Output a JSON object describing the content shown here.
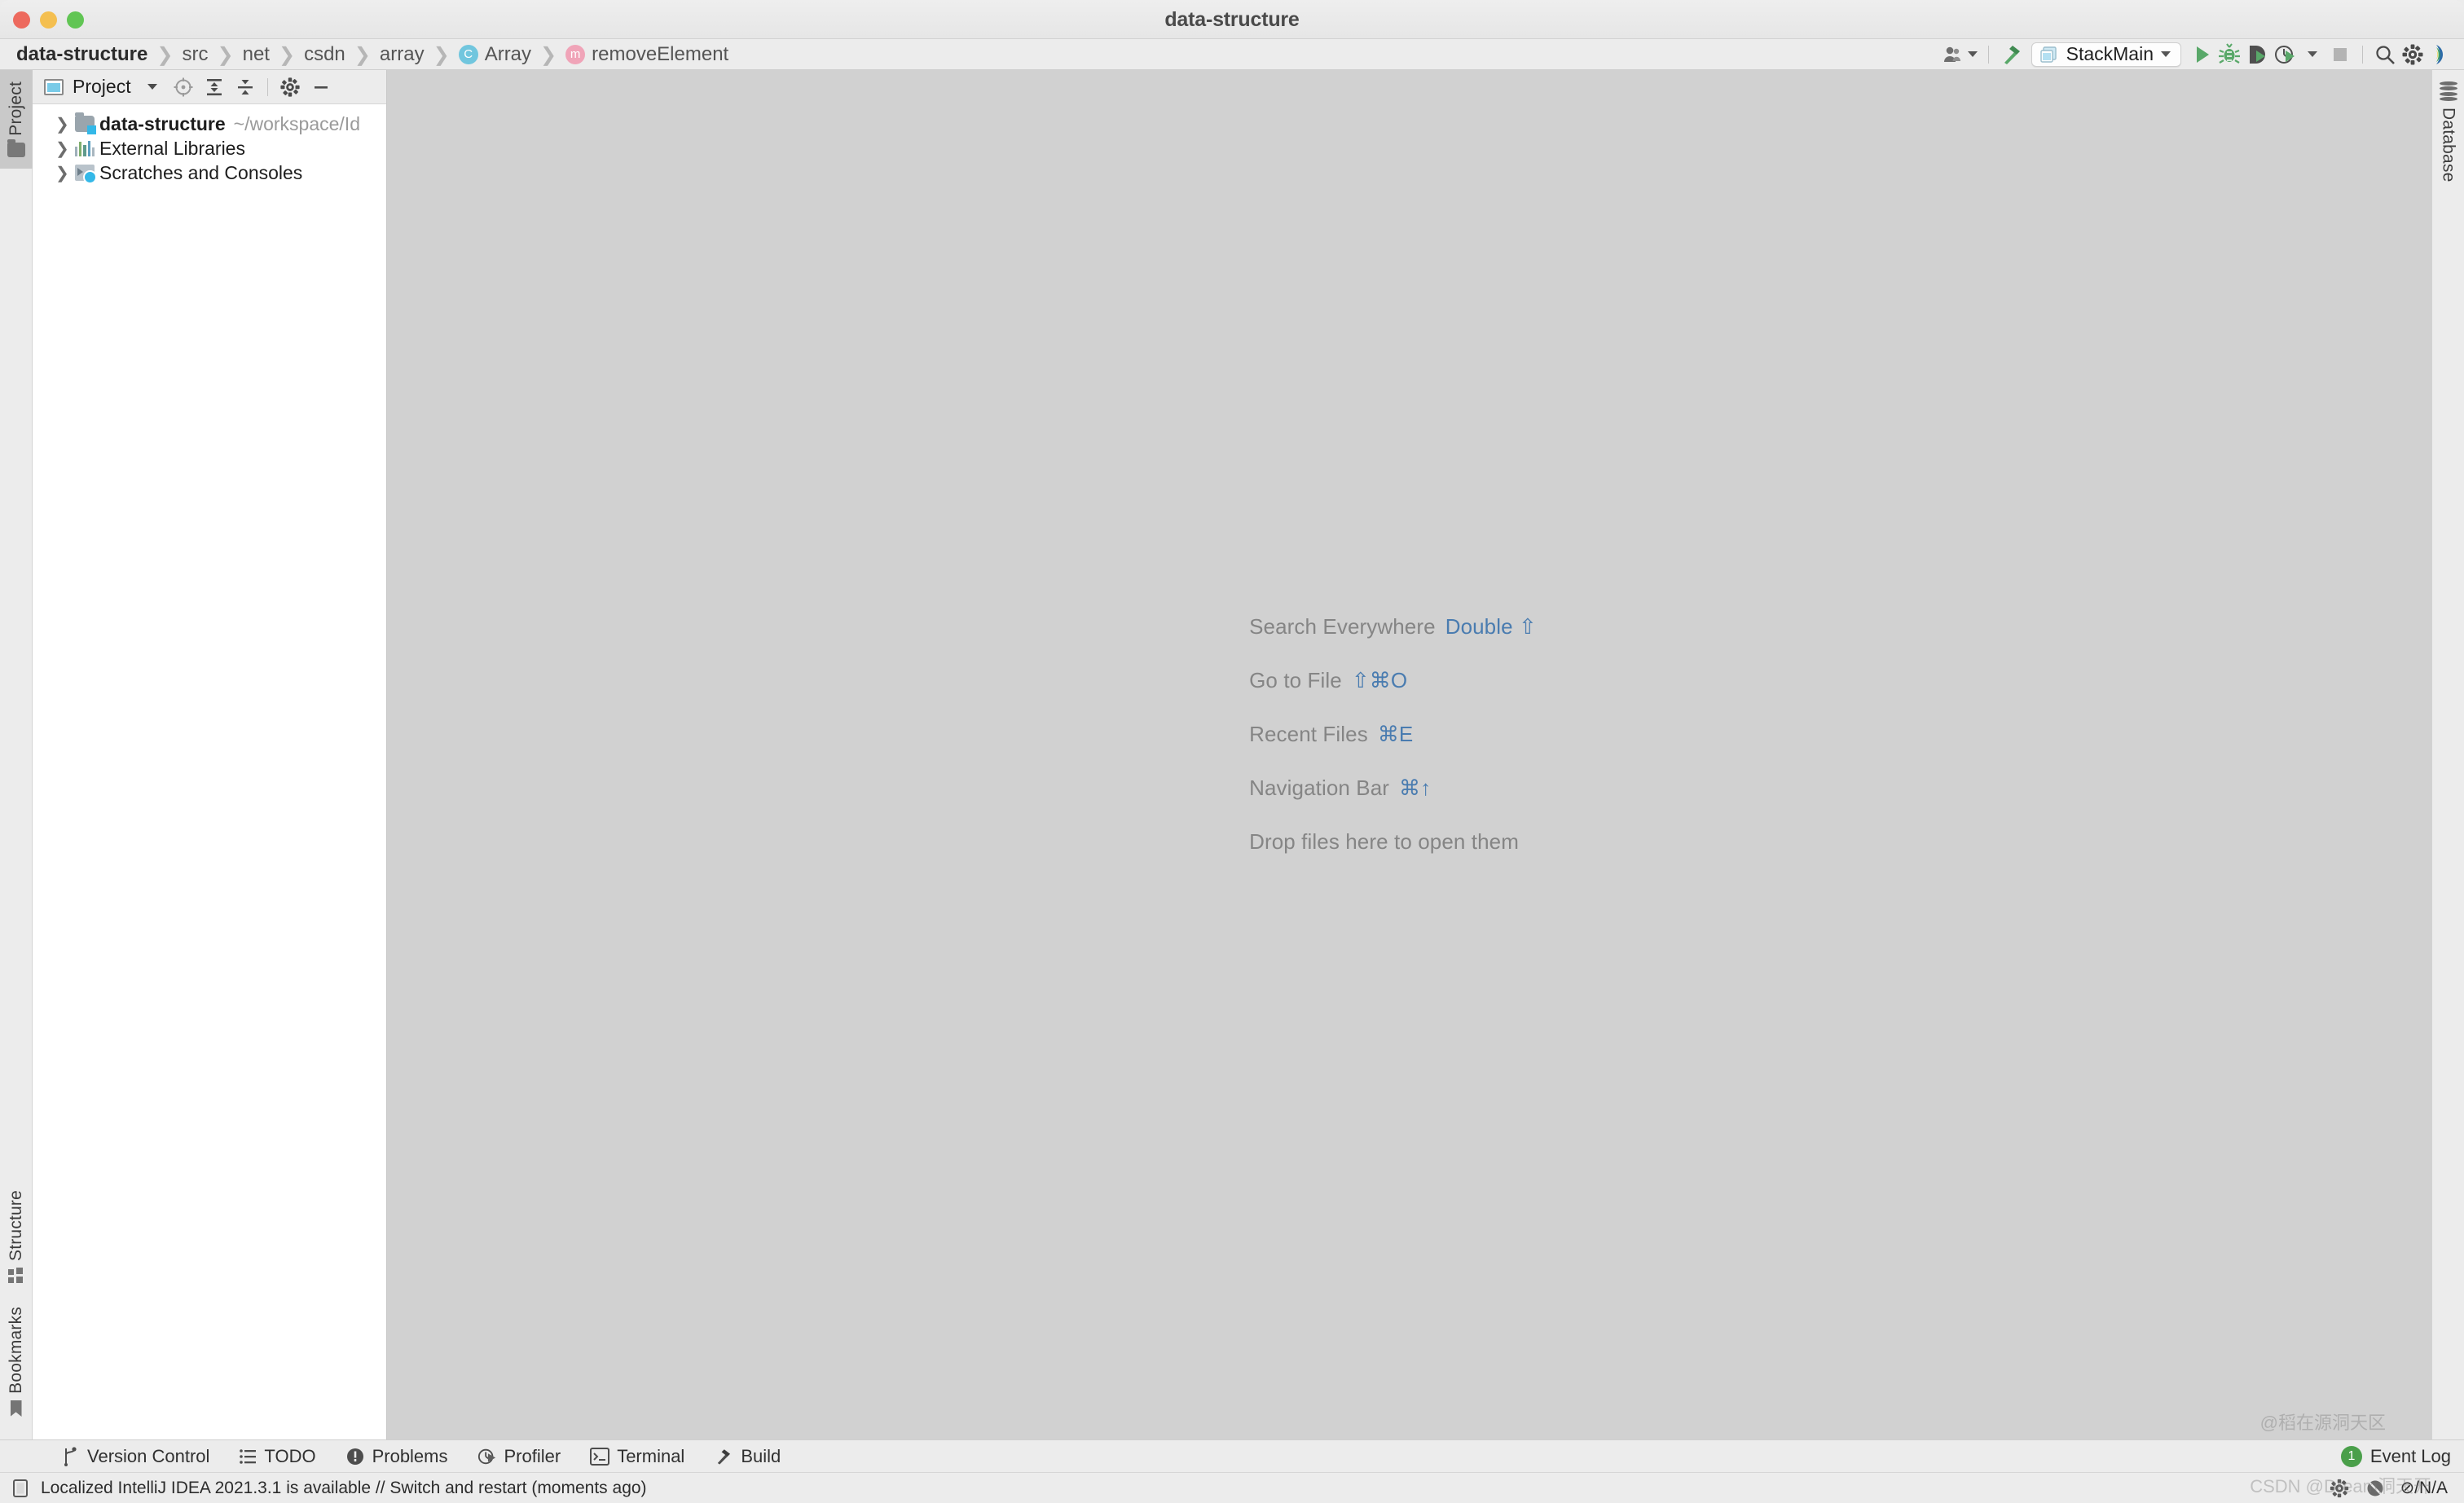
{
  "window": {
    "title": "data-structure",
    "traffic_lights": [
      "close",
      "minimize",
      "maximize"
    ]
  },
  "breadcrumb": [
    {
      "label": "data-structure",
      "icon": ""
    },
    {
      "label": "src",
      "icon": ""
    },
    {
      "label": "net",
      "icon": ""
    },
    {
      "label": "csdn",
      "icon": ""
    },
    {
      "label": "array",
      "icon": ""
    },
    {
      "label": "Array",
      "icon": "class-icon",
      "badge": "C"
    },
    {
      "label": "removeElement",
      "icon": "method-icon",
      "badge": "m"
    }
  ],
  "toolbar": {
    "avatar_label": "account-icon",
    "build_label": "build-hammer-icon",
    "run_config": "StackMain",
    "run_label": "run-icon",
    "debug_label": "debug-icon",
    "coverage_label": "run-with-coverage-icon",
    "profiler_label": "profile-icon",
    "stop_label": "stop-icon",
    "search_label": "search-icon",
    "settings_label": "settings-gear-icon",
    "updates_label": "ide-updates-icon"
  },
  "project_panel": {
    "title": "Project",
    "buttons": [
      "select-opened-file-icon",
      "expand-all-icon",
      "collapse-all-icon",
      "settings-gear-icon",
      "hide-icon"
    ],
    "tree": [
      {
        "label": "data-structure",
        "sub": "~/workspace/Id",
        "icon": "module-icon",
        "bold": true,
        "expanded": false
      },
      {
        "label": "External Libraries",
        "sub": "",
        "icon": "library-icon",
        "bold": false,
        "expanded": false
      },
      {
        "label": "Scratches and Consoles",
        "sub": "",
        "icon": "scratch-icon",
        "bold": false,
        "expanded": false
      }
    ]
  },
  "stripes": {
    "left_top": [
      {
        "label": "Project",
        "icon": "folder-icon",
        "active": true
      }
    ],
    "left_bottom": [
      {
        "label": "Structure",
        "icon": "structure-icon",
        "active": false
      },
      {
        "label": "Bookmarks",
        "icon": "bookmark-icon",
        "active": false
      }
    ],
    "right_top": [
      {
        "label": "Database",
        "icon": "database-icon",
        "active": false
      }
    ]
  },
  "editor_hints": [
    {
      "text": "Search Everywhere",
      "keys": "Double ⇧"
    },
    {
      "text": "Go to File",
      "keys": "⇧⌘O"
    },
    {
      "text": "Recent Files",
      "keys": "⌘E"
    },
    {
      "text": "Navigation Bar",
      "keys": "⌘↑"
    },
    {
      "text": "Drop files here to open them",
      "keys": ""
    }
  ],
  "bottom_bar": {
    "items": [
      {
        "label": "Version Control",
        "icon": "branch-icon"
      },
      {
        "label": "TODO",
        "icon": "todo-list-icon"
      },
      {
        "label": "Problems",
        "icon": "problems-icon"
      },
      {
        "label": "Profiler",
        "icon": "profiler-icon"
      },
      {
        "label": "Terminal",
        "icon": "terminal-icon"
      },
      {
        "label": "Build",
        "icon": "build-hammer-icon"
      }
    ],
    "event_log": {
      "label": "Event Log",
      "count": "1"
    }
  },
  "status_bar": {
    "icon": "notification-widget-icon",
    "message": "Localized IntelliJ IDEA 2021.3.1 is available // Switch and restart (moments ago)",
    "memory": "⊘/N/A",
    "right_icons": [
      "settings-gear-icon",
      "notifications-disabled-icon"
    ]
  },
  "watermarks": {
    "top": "@稻在源洞天区",
    "bottom": "CSDN @Dream洞天开"
  },
  "colors": {
    "accent_blue": "#4a7cb0",
    "class_icon": "#71c6de",
    "method_icon": "#f0a4b8",
    "run_green": "#59a869",
    "editor_bg": "#d1d1d1",
    "chrome_bg": "#ececec",
    "panel_bg": "#ffffff"
  }
}
